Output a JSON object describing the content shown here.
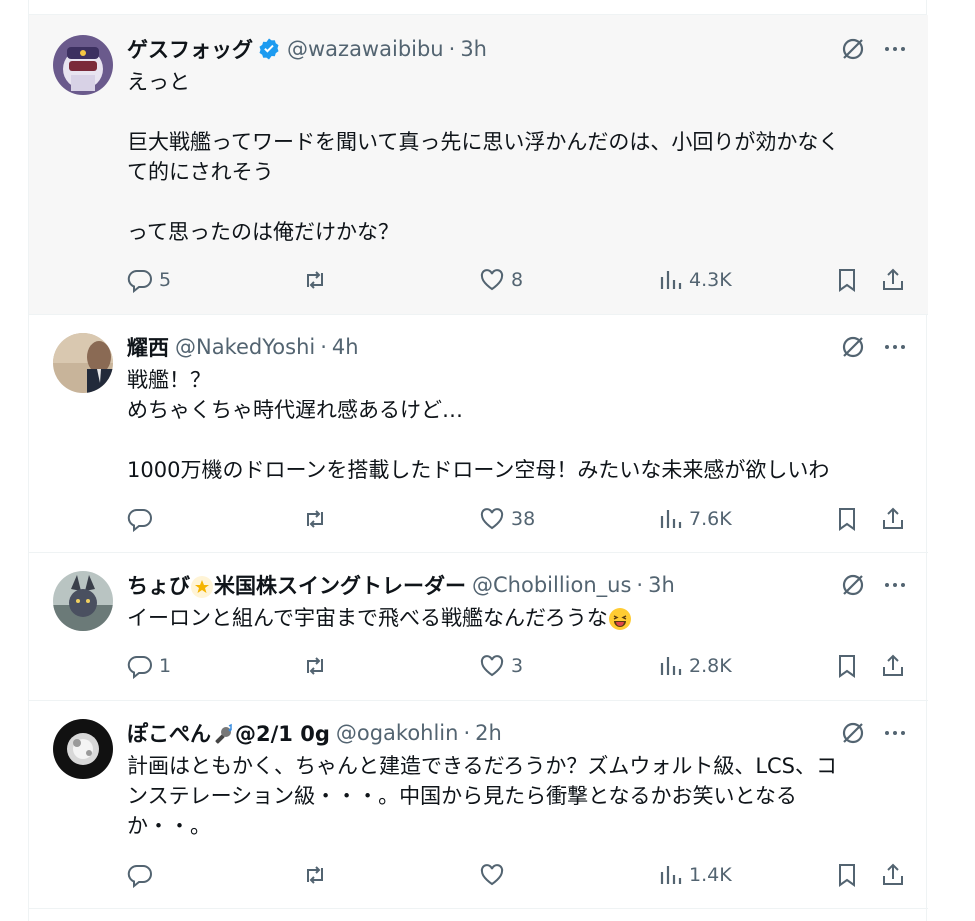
{
  "tweets": [
    {
      "name": "ゲスフォッグ",
      "verified": true,
      "handle": "@wazawaibibu",
      "time": "3h",
      "body": "えっと\n\n巨大戦艦ってワードを聞いて真っ先に思い浮かんだのは、小回りが効かなく\nて的にされそう\n\nって思ったのは俺だけかな？",
      "replies": "5",
      "retweets": "",
      "likes": "8",
      "views": "4.3K"
    },
    {
      "name": "耀西",
      "verified": false,
      "handle": "@NakedYoshi",
      "time": "4h",
      "body": "戦艦！？\nめちゃくちゃ時代遅れ感あるけど…\n\n1000万機のドローンを搭載したドローン空母！みたいな未来感が欲しいわ",
      "replies": "",
      "retweets": "",
      "likes": "38",
      "views": "7.6K"
    },
    {
      "name_prefix": "ちょび",
      "name_suffix": "米国株スイングトレーダー",
      "name_emoji": "dizzy-star-emoji",
      "verified": false,
      "handle": "@Chobillion_us",
      "time": "3h",
      "body": "イーロンと組んで宇宙まで飛べる戦艦なんだろうな",
      "body_emoji": "grinning-squinting-face-emoji",
      "replies": "1",
      "retweets": "",
      "likes": "3",
      "views": "2.8K"
    },
    {
      "name_prefix": "ぽこぺん",
      "name_suffix": "@2/1 0g",
      "name_emoji": "microphone-music-emoji",
      "verified": false,
      "handle": "@ogakohlin",
      "time": "2h",
      "body": "計画はともかく、ちゃんと建造できるだろうか？ズムウォルト級、LCS、コ\nンステレーション級・・・。中国から見たら衝撃となるかお笑いとなる\nか・・。",
      "replies": "",
      "retweets": "",
      "likes": "",
      "views": "1.4K"
    }
  ],
  "icons": {
    "reply": "reply-icon",
    "retweet": "retweet-icon",
    "like": "heart-icon",
    "views": "views-icon",
    "bookmark": "bookmark-icon",
    "share": "share-icon",
    "grok": "grok-icon",
    "more": "more-icon"
  },
  "colors": {
    "verified": "#1d9bf0",
    "secondary_text": "#536471",
    "highlight_bg": "#f7f7f7"
  }
}
